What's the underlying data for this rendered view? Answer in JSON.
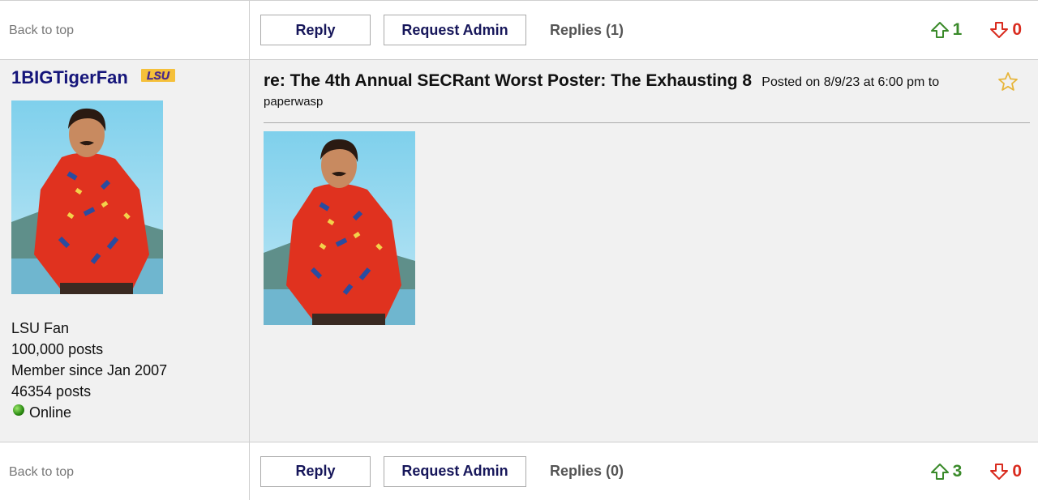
{
  "top_bar": {
    "back_to_top": "Back to top",
    "reply_label": "Reply",
    "request_admin_label": "Request Admin",
    "replies_label": "Replies (1)",
    "upvotes": "1",
    "downvotes": "0"
  },
  "user": {
    "name": "1BIGTigerFan",
    "team_logo_text": "LSU",
    "fan_of": "LSU Fan",
    "posts_total": "100,000 posts",
    "member_since": "Member since Jan 2007",
    "posts": "46354 posts",
    "status": "Online"
  },
  "post": {
    "title": "re: The 4th Annual SECRant Worst Poster: The Exhausting 8",
    "meta": "Posted on 8/9/23 at 6:00 pm to",
    "to_user": "paperwasp"
  },
  "bottom_bar": {
    "back_to_top": "Back to top",
    "reply_label": "Reply",
    "request_admin_label": "Request Admin",
    "replies_label": "Replies (0)",
    "upvotes": "3",
    "downvotes": "0"
  },
  "colors": {
    "username": "#15157a",
    "upvote": "#3a8a2a",
    "downvote": "#d92b1e",
    "lsu_gold": "#f5c03a",
    "lsu_purple": "#4a2a8a"
  },
  "icons": {
    "upvote": "arrow-up-outline-icon",
    "downvote": "arrow-down-outline-icon",
    "favorite": "star-outline-icon",
    "status": "green-dot-icon"
  }
}
